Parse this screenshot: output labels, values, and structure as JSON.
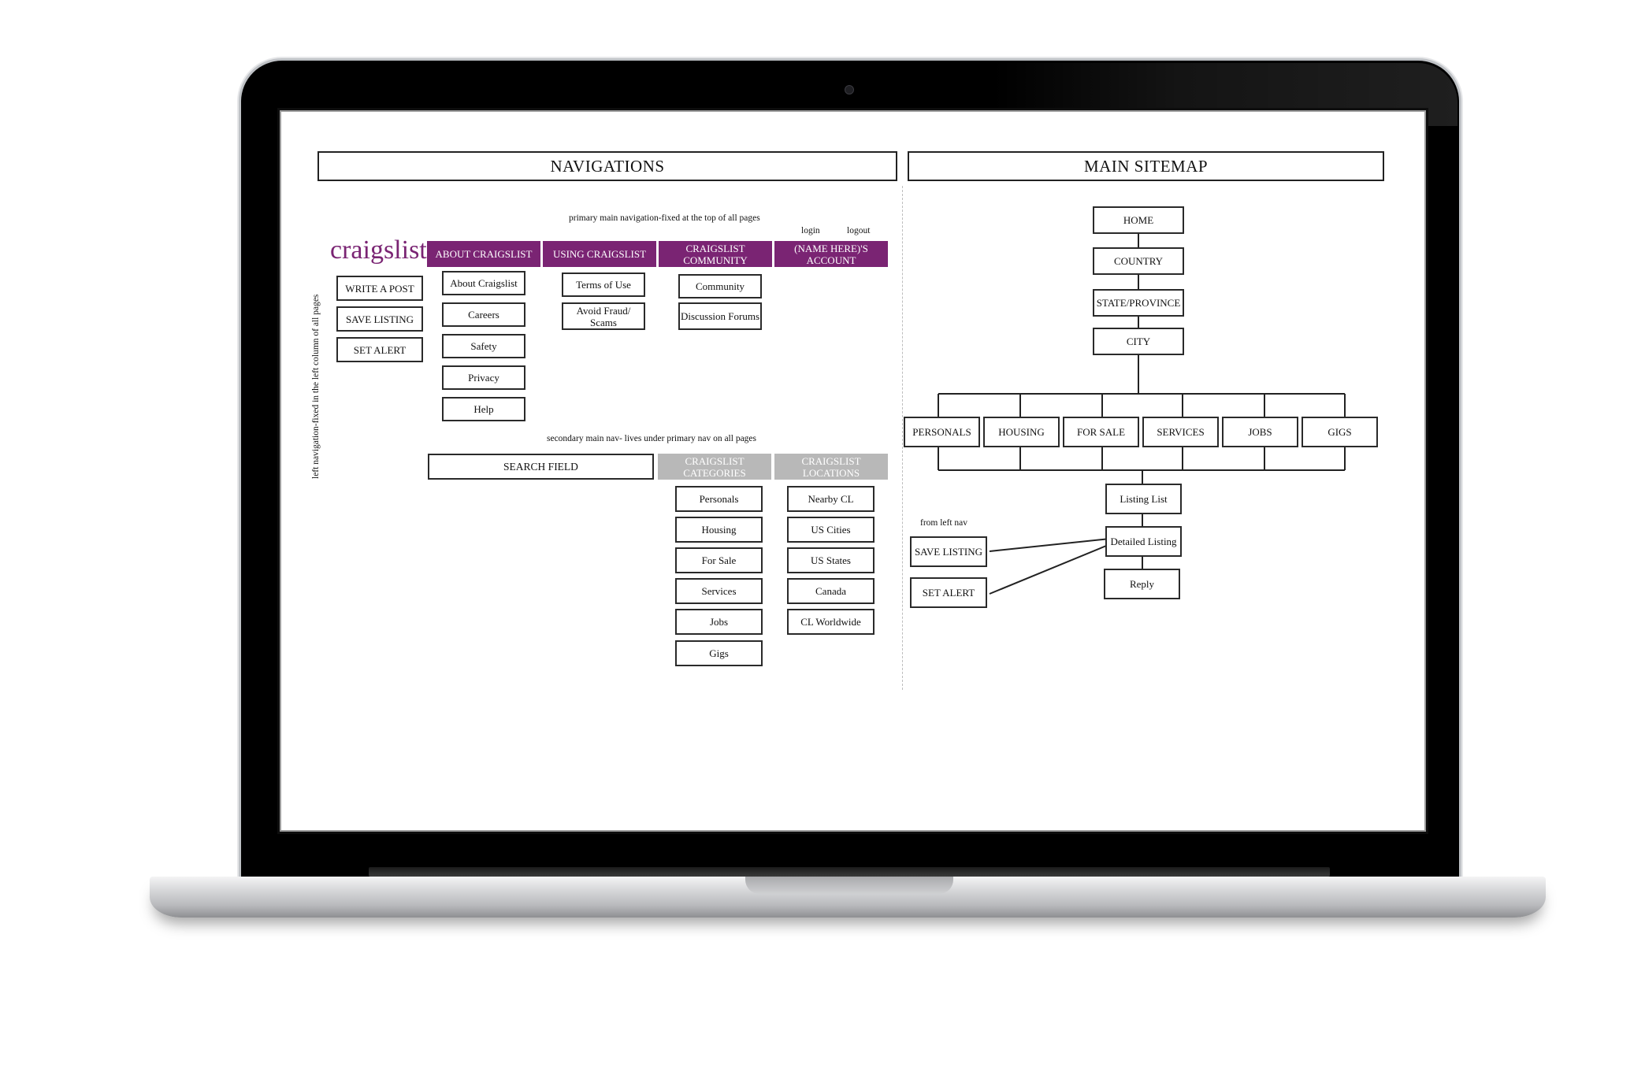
{
  "colors": {
    "primary_nav": "#7a2473",
    "secondary_nav": "#b8b8b8",
    "logo": "#7a2473"
  },
  "navigations": {
    "title": "NAVIGATIONS",
    "primary_note": "primary main navigation-fixed at the top of all pages",
    "logo": "craigslist",
    "login": "login",
    "logout": "logout",
    "primary_nav": [
      {
        "label": "ABOUT CRAIGSLIST",
        "items": [
          "About Craigslist",
          "Careers",
          "Safety",
          "Privacy",
          "Help"
        ]
      },
      {
        "label": "USING CRAIGSLIST",
        "items": [
          "Terms of Use",
          "Avoid Fraud/ Scams"
        ]
      },
      {
        "label": "CRAIGSLIST COMMUNITY",
        "items": [
          "Community",
          "Discussion Forums"
        ]
      },
      {
        "label": "(NAME HERE)'S ACCOUNT",
        "items": []
      }
    ],
    "left_nav_label": "left navigation-fixed in the left column of all pages",
    "left_nav": [
      "WRITE A POST",
      "SAVE LISTING",
      "SET ALERT"
    ],
    "secondary_note": "secondary main nav- lives under primary nav on all pages",
    "search_field": "SEARCH FIELD",
    "secondary_nav": [
      {
        "label": "CRAIGSLIST CATEGORIES",
        "items": [
          "Personals",
          "Housing",
          "For Sale",
          "Services",
          "Jobs",
          "Gigs"
        ]
      },
      {
        "label": "CRAIGSLIST LOCATIONS",
        "items": [
          "Nearby CL",
          "US Cities",
          "US States",
          "Canada",
          "CL Worldwide"
        ]
      }
    ]
  },
  "sitemap": {
    "title": "MAIN SITEMAP",
    "hierarchy": [
      "HOME",
      "COUNTRY",
      "STATE/PROVINCE",
      "CITY"
    ],
    "categories": [
      "PERSONALS",
      "HOUSING",
      "FOR SALE",
      "SERVICES",
      "JOBS",
      "GIGS"
    ],
    "listing_flow": [
      "Listing List",
      "Detailed Listing",
      "Reply"
    ],
    "from_left_nav_label": "from left nav",
    "left_nav_links": [
      "SAVE LISTING",
      "SET ALERT"
    ]
  }
}
